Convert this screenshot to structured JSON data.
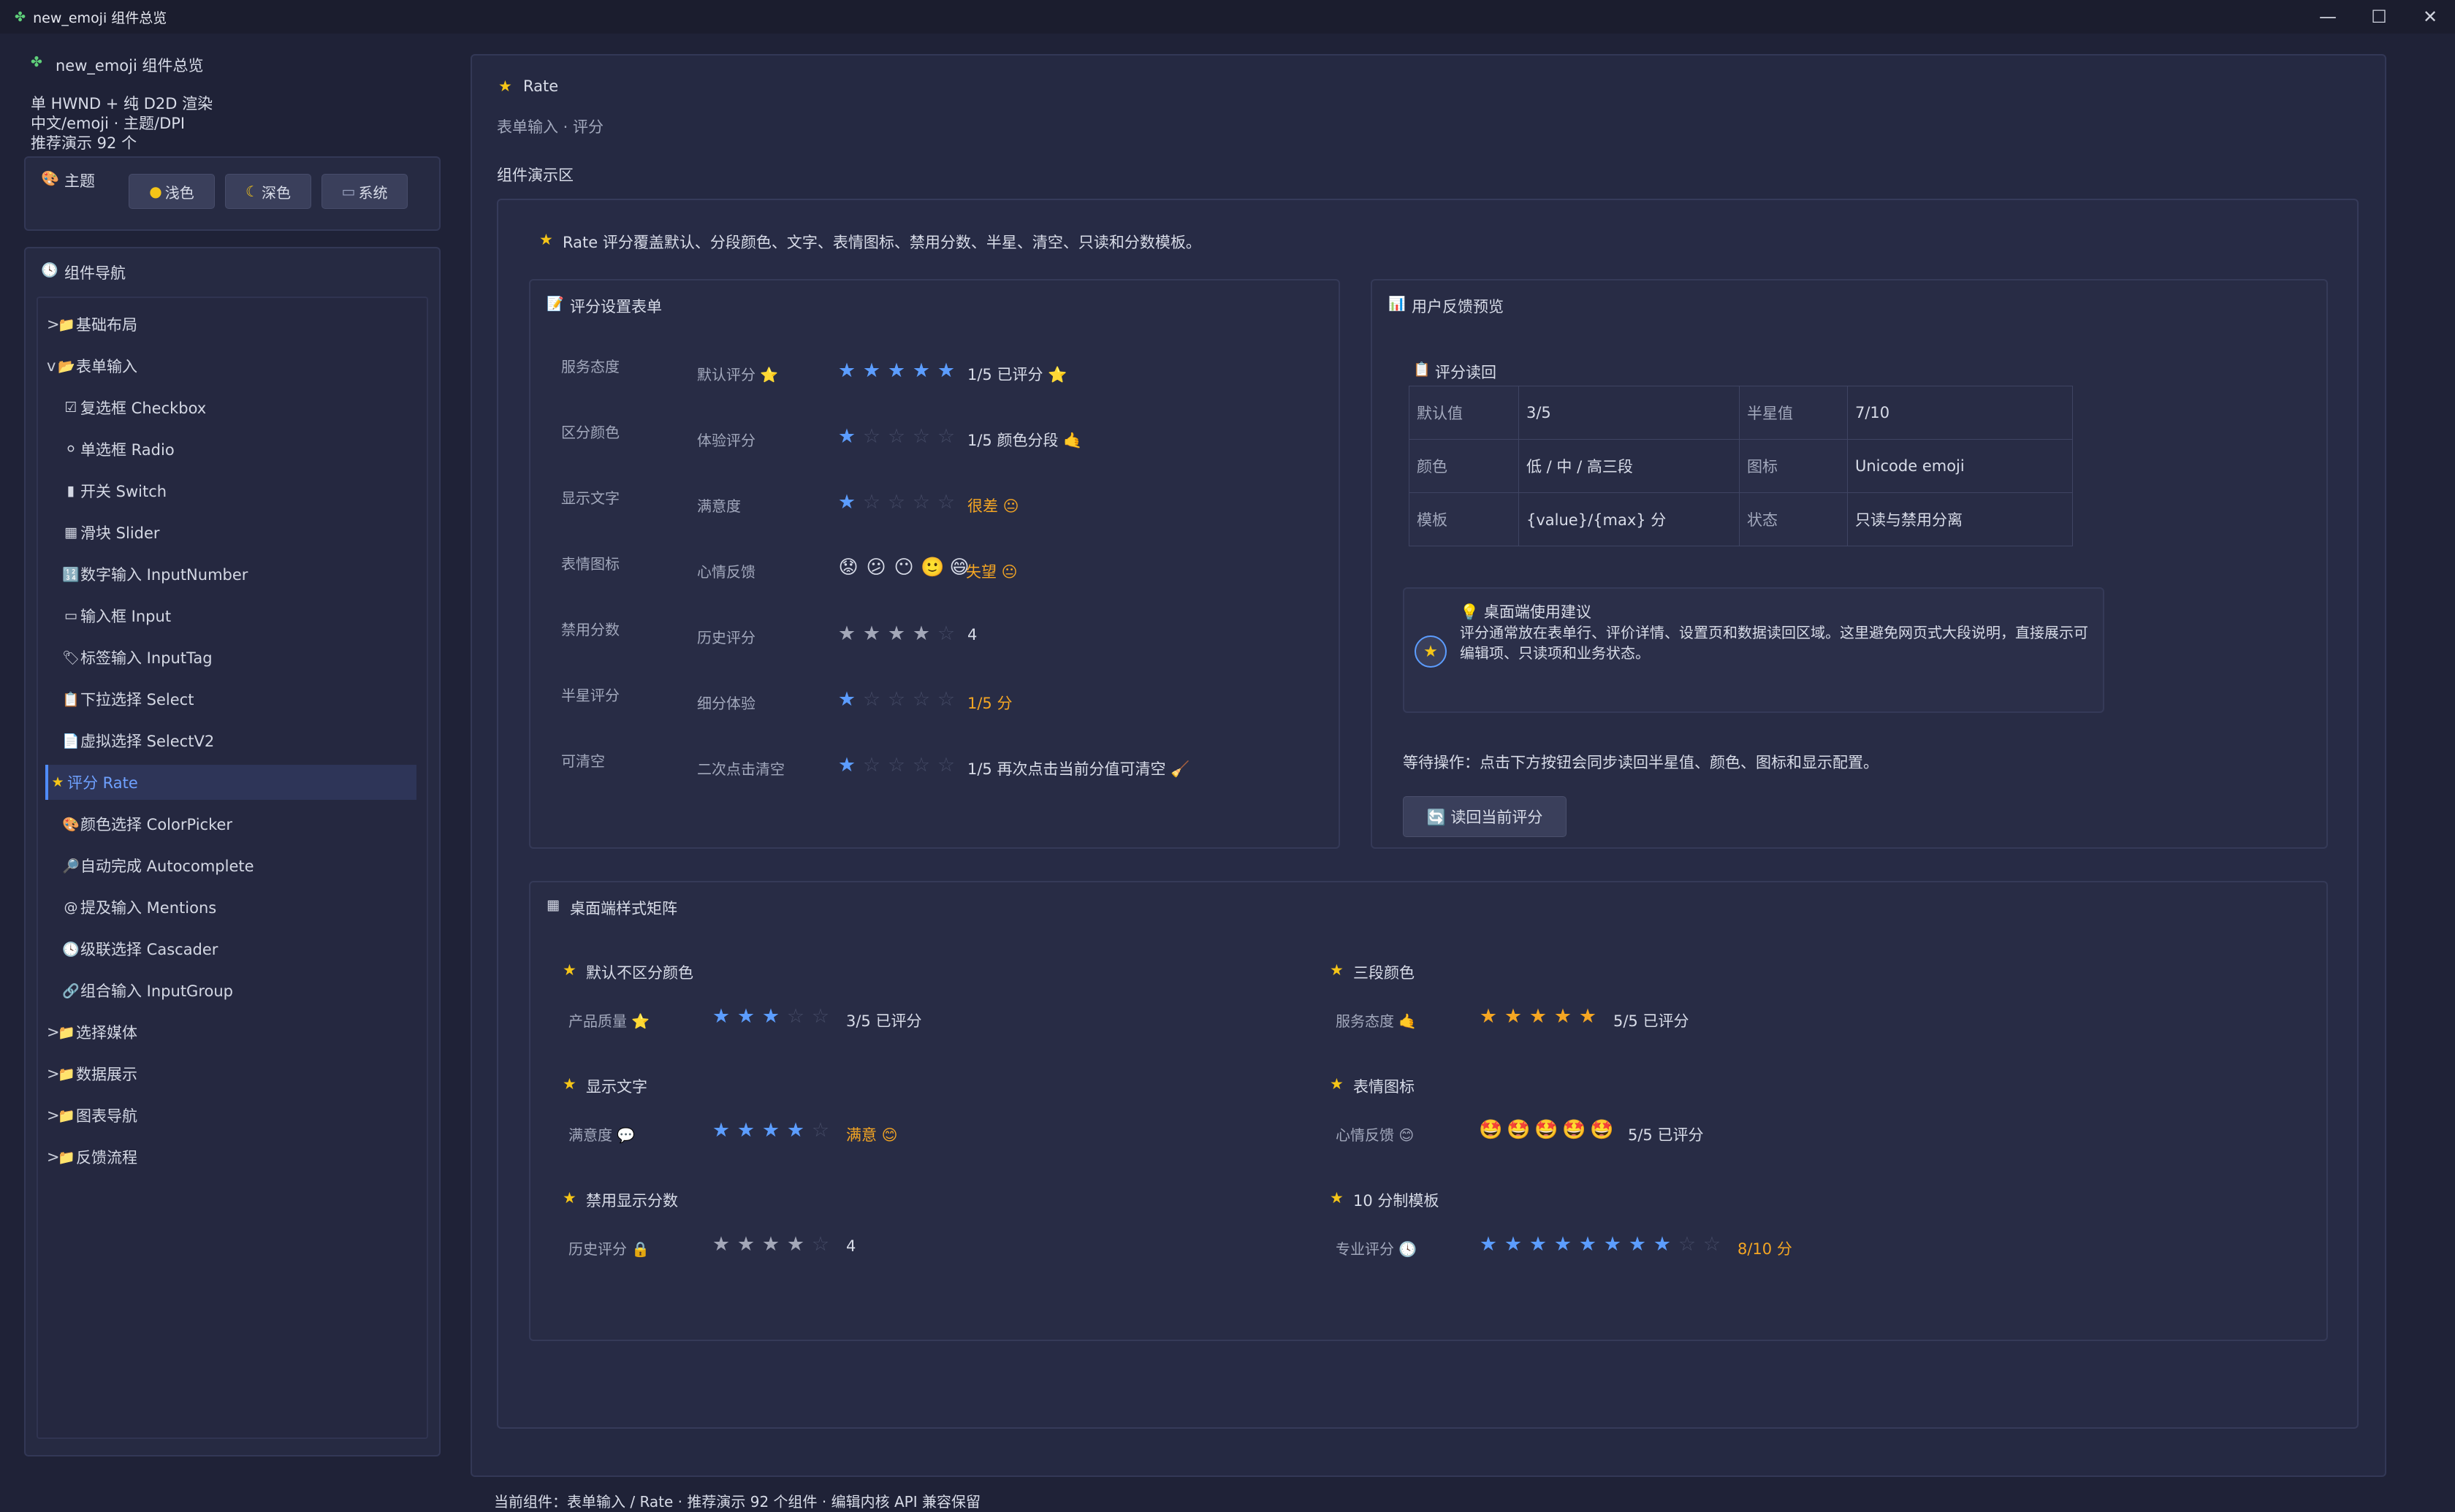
{
  "window": {
    "title": "new_emoji 组件总览",
    "icon": "puzzle-icon"
  },
  "sidebar": {
    "app_title": "new_emoji 组件总览",
    "info": [
      "单 HWND + 纯 D2D 渲染",
      "中文/emoji · 主题/DPI",
      "推荐演示 92 个"
    ],
    "theme": {
      "label": "主题",
      "icon": "palette-icon",
      "buttons": [
        {
          "label": "浅色",
          "icon": "sun-icon"
        },
        {
          "label": "深色",
          "icon": "moon-icon"
        },
        {
          "label": "系统",
          "icon": "laptop-icon"
        }
      ]
    },
    "nav_title": "组件导航",
    "nav": [
      {
        "label": "基础布局",
        "caret": ">",
        "icon": "📁",
        "level": 0
      },
      {
        "label": "表单输入",
        "caret": "v",
        "icon": "📂",
        "level": 0
      },
      {
        "label": "复选框 Checkbox",
        "icon": "☑",
        "level": 1
      },
      {
        "label": "单选框 Radio",
        "icon": "⚪",
        "level": 1
      },
      {
        "label": "开关 Switch",
        "icon": "▮",
        "level": 1
      },
      {
        "label": "滑块 Slider",
        "icon": "▦",
        "level": 1
      },
      {
        "label": "数字输入 InputNumber",
        "icon": "🔢",
        "level": 1
      },
      {
        "label": "输入框 Input",
        "icon": "▭",
        "level": 1
      },
      {
        "label": "标签输入 InputTag",
        "icon": "🏷",
        "level": 1
      },
      {
        "label": "下拉选择 Select",
        "icon": "📋",
        "level": 1
      },
      {
        "label": "虚拟选择 SelectV2",
        "icon": "📄",
        "level": 1
      },
      {
        "label": "评分 Rate",
        "icon": "★",
        "level": 1,
        "active": true
      },
      {
        "label": "颜色选择 ColorPicker",
        "icon": "🎨",
        "level": 1
      },
      {
        "label": "自动完成 Autocomplete",
        "icon": "🔎",
        "level": 1
      },
      {
        "label": "提及输入 Mentions",
        "icon": "@",
        "level": 1
      },
      {
        "label": "级联选择 Cascader",
        "icon": "🕓",
        "level": 1
      },
      {
        "label": "组合输入 InputGroup",
        "icon": "🔗",
        "level": 1
      },
      {
        "label": "选择媒体",
        "caret": ">",
        "icon": "📁",
        "level": 0
      },
      {
        "label": "数据展示",
        "caret": ">",
        "icon": "📁",
        "level": 0
      },
      {
        "label": "图表导航",
        "caret": ">",
        "icon": "📁",
        "level": 0
      },
      {
        "label": "反馈流程",
        "caret": ">",
        "icon": "📁",
        "level": 0
      }
    ]
  },
  "main": {
    "title": "Rate",
    "subtitle": "表单输入 · 评分",
    "demo_title": "组件演示区",
    "intro": "Rate 评分覆盖默认、分段颜色、文字、表情图标、禁用分数、半星、清空、只读和分数模板。",
    "form": {
      "title": "评分设置表单",
      "rows": [
        {
          "section": "服务态度",
          "label": "默认评分 ⭐",
          "value": 5,
          "max": 5,
          "style": "blue",
          "text": "1/5 已评分 ⭐",
          "text_style": "normal"
        },
        {
          "section": "区分颜色",
          "label": "体验评分",
          "value": 1,
          "max": 5,
          "style": "blue",
          "text": "1/5 颜色分段 🤙",
          "text_style": "normal"
        },
        {
          "section": "显示文字",
          "label": "满意度",
          "value": 1,
          "max": 5,
          "style": "blue",
          "text": "很差 😐",
          "text_style": "orange"
        },
        {
          "section": "表情图标",
          "label": "心情反馈",
          "value": 5,
          "max": 5,
          "style": "emoji",
          "emoji": [
            "😟",
            "😕",
            "😶",
            "🙂",
            "😄"
          ],
          "text": "失望 😐",
          "text_style": "orange"
        },
        {
          "section": "禁用分数",
          "label": "历史评分",
          "value": 4,
          "max": 5,
          "style": "grey",
          "text": "4",
          "text_style": "normal"
        },
        {
          "section": "半星评分",
          "label": "细分体验",
          "value": 1,
          "max": 5,
          "style": "blue",
          "text": "1/5 分",
          "text_style": "orange"
        },
        {
          "section": "可清空",
          "label": "二次点击清空",
          "value": 1,
          "max": 5,
          "style": "blue",
          "text": "1/5 再次点击当前分值可清空 🧹",
          "text_style": "normal"
        }
      ]
    },
    "preview": {
      "title": "用户反馈预览",
      "readback_title": "评分读回",
      "table": [
        [
          "默认值",
          "3/5",
          "半星值",
          "7/10"
        ],
        [
          "颜色",
          "低 / 中 / 高三段",
          "图标",
          "Unicode emoji"
        ],
        [
          "模板",
          "{value}/{max} 分",
          "状态",
          "只读与禁用分离"
        ]
      ],
      "tip_title": "💡 桌面端使用建议",
      "tip_text": "评分通常放在表单行、评价详情、设置页和数据读回区域。这里避免网页式大段说明，直接展示可编辑项、只读项和业务状态。",
      "status": "等待操作：点击下方按钮会同步读回半星值、颜色、图标和显示配置。",
      "button": "🔄 读回当前评分"
    },
    "matrix": {
      "title": "桌面端样式矩阵",
      "cells": [
        {
          "title": "默认不区分颜色",
          "label": "产品质量 ⭐",
          "value": 3,
          "max": 5,
          "style": "blue",
          "text": "3/5 已评分",
          "text_style": "normal"
        },
        {
          "title": "三段颜色",
          "label": "服务态度 🤙",
          "value": 5,
          "max": 5,
          "style": "gold",
          "text": "5/5 已评分",
          "text_style": "normal"
        },
        {
          "title": "显示文字",
          "label": "满意度 💬",
          "value": 4,
          "max": 5,
          "style": "blue",
          "text": "满意 😊",
          "text_style": "orange"
        },
        {
          "title": "表情图标",
          "label": "心情反馈 😊",
          "value": 5,
          "max": 5,
          "style": "emoji",
          "emoji": [
            "🤩",
            "🤩",
            "🤩",
            "🤩",
            "🤩"
          ],
          "text": "5/5 已评分",
          "text_style": "normal"
        },
        {
          "title": "禁用显示分数",
          "label": "历史评分 🔒",
          "value": 4,
          "max": 5,
          "style": "grey",
          "text": "4",
          "text_style": "normal"
        },
        {
          "title": "10 分制模板",
          "label": "专业评分 🕓",
          "value": 8,
          "max": 10,
          "style": "blue",
          "text": "8/10 分",
          "text_style": "orange"
        }
      ]
    }
  },
  "statusbar": "当前组件：表单输入 / Rate · 推荐演示 92 个组件 · 编辑内核 API 兼容保留"
}
